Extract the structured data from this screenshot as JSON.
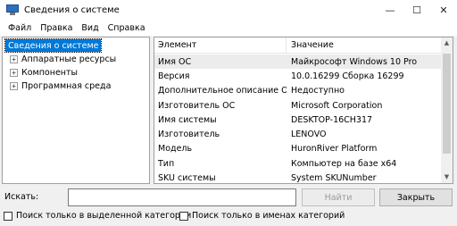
{
  "window": {
    "title": "Сведения о системе",
    "minimize_glyph": "—",
    "maximize_glyph": "☐",
    "close_glyph": "✕"
  },
  "menu": [
    "Файл",
    "Правка",
    "Вид",
    "Справка"
  ],
  "tree": {
    "root": "Сведения о системе",
    "children": [
      {
        "label": "Аппаратные ресурсы",
        "expander": "+"
      },
      {
        "label": "Компоненты",
        "expander": "+"
      },
      {
        "label": "Программная среда",
        "expander": "+"
      }
    ]
  },
  "list": {
    "headers": {
      "element": "Элемент",
      "value": "Значение"
    },
    "rows": [
      {
        "element": "Имя ОС",
        "value": "Майкрософт Windows 10 Pro"
      },
      {
        "element": "Версия",
        "value": "10.0.16299 Сборка 16299"
      },
      {
        "element": "Дополнительное описание ОС",
        "value": "Недоступно"
      },
      {
        "element": "Изготовитель ОС",
        "value": "Microsoft Corporation"
      },
      {
        "element": "Имя системы",
        "value": "DESKTOP-16CH317"
      },
      {
        "element": "Изготовитель",
        "value": "LENOVO"
      },
      {
        "element": "Модель",
        "value": "HuronRiver Platform"
      },
      {
        "element": "Тип",
        "value": "Компьютер на базе x64"
      },
      {
        "element": "SKU системы",
        "value": "System SKUNumber"
      }
    ],
    "selected_row": 0
  },
  "search": {
    "label": "Искать:",
    "value": "",
    "find_button": "Найти",
    "close_button": "Закрыть",
    "checkbox_selected_category": "Поиск только в выделенной категории",
    "checkbox_category_names": "Поиск только в именах категорий"
  },
  "icons": {
    "app": "system-info-icon",
    "scroll_up": "▲",
    "scroll_down": "▼"
  }
}
